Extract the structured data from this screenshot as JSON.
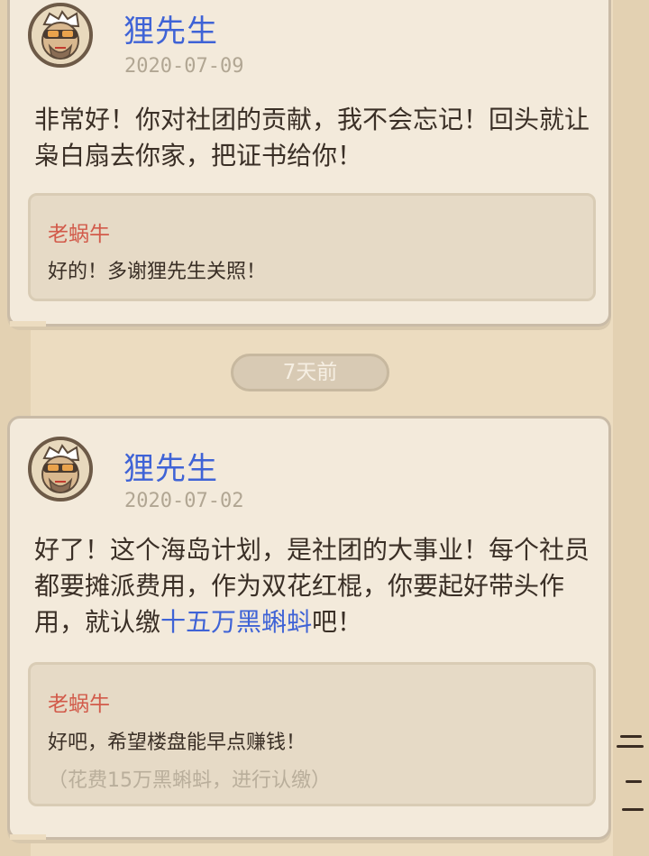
{
  "posts": [
    {
      "author": "狸先生",
      "date": "2020-07-09",
      "message": "非常好！你对社团的贡献，我不会忘记！回头就让枭白扇去你家，把证书给你！",
      "reply": {
        "author": "老蜗牛",
        "text": "好的！多谢狸先生关照！"
      }
    },
    {
      "author": "狸先生",
      "date": "2020-07-02",
      "message_pre": "好了！这个海岛计划，是社团的大事业！每个社员都要摊派费用，作为双花红棍，你要起好带头作用，就认缴",
      "message_highlight": "十五万黑蝌蚪",
      "message_post": "吧！",
      "reply": {
        "author": "老蜗牛",
        "text": "好吧，希望楼盘能早点赚钱！",
        "note": "（花费15万黑蝌蚪，进行认缴）"
      }
    }
  ],
  "time_divider": "7天前",
  "colors": {
    "author": "#3f63d6",
    "reply_author": "#d25a4a",
    "highlight": "#3f63d6"
  },
  "icons": [
    "avatar-raccoon-icon"
  ]
}
